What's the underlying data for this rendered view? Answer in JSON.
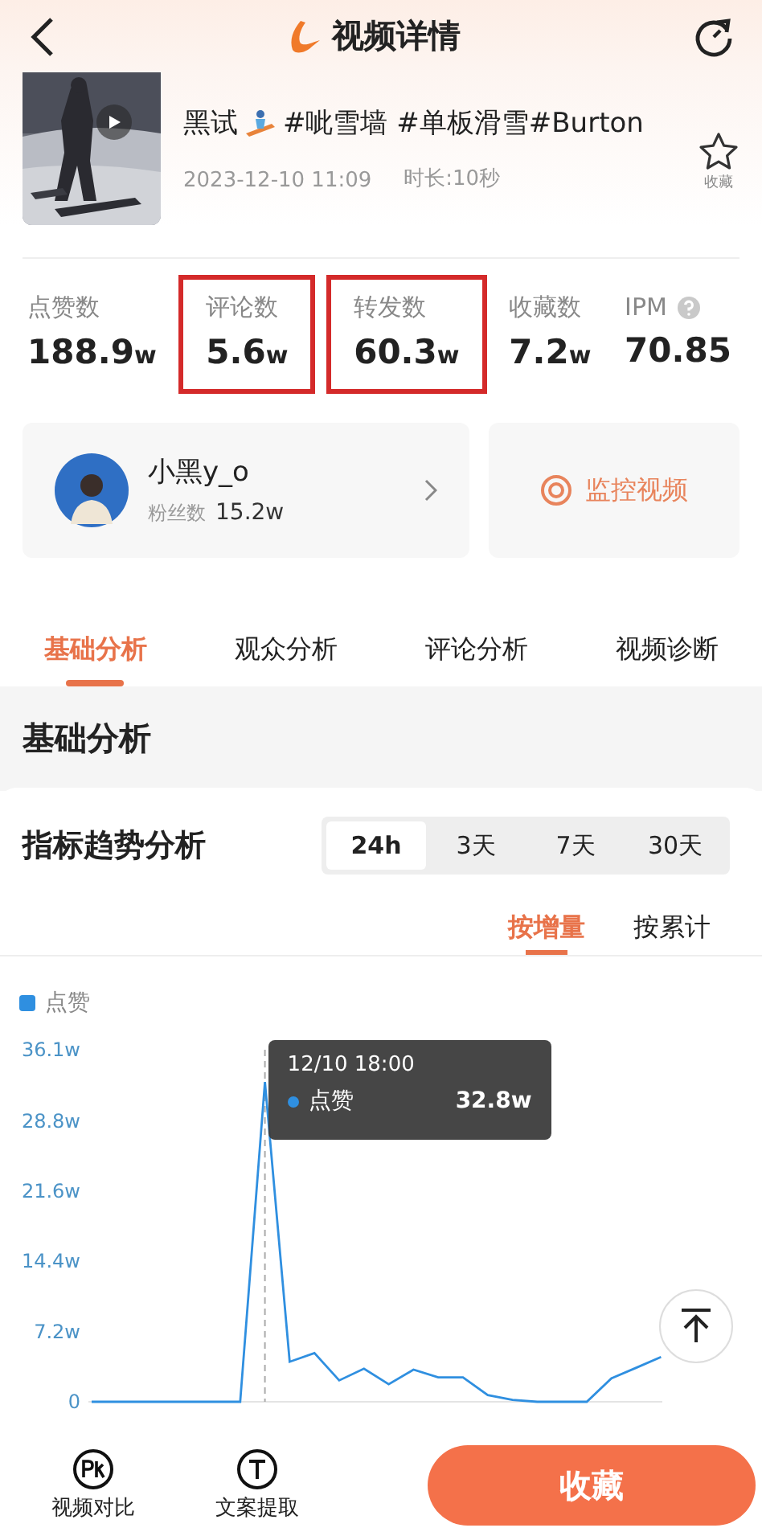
{
  "header": {
    "title": "视频详情"
  },
  "video": {
    "caption_start": "黑试",
    "caption_end": "#呲雪墙 #单板滑雪#Burton",
    "date": "2023-12-10 11:09",
    "duration": "时长:10秒",
    "favorite_label": "收藏"
  },
  "stats": [
    {
      "label": "点赞数",
      "value": "188.9",
      "unit": "w",
      "highlighted": false,
      "help": false
    },
    {
      "label": "评论数",
      "value": "5.6",
      "unit": "w",
      "highlighted": true,
      "help": false
    },
    {
      "label": "转发数",
      "value": "60.3",
      "unit": "w",
      "highlighted": true,
      "help": false
    },
    {
      "label": "收藏数",
      "value": "7.2",
      "unit": "w",
      "highlighted": false,
      "help": false
    },
    {
      "label": "IPM",
      "value": "70.85",
      "highlighted": false,
      "help": true
    }
  ],
  "author": {
    "name": "小黑y_o",
    "followers_label": "粉丝数",
    "followers": "15.2w"
  },
  "monitor_button": "监控视频",
  "tabs": [
    {
      "label": "基础分析",
      "selected": true
    },
    {
      "label": "观众分析",
      "selected": false
    },
    {
      "label": "评论分析",
      "selected": false
    },
    {
      "label": "视频诊断",
      "selected": false
    }
  ],
  "section_title": "基础分析",
  "trend": {
    "title": "指标趋势分析",
    "ranges": [
      {
        "label": "24h",
        "selected": true
      },
      {
        "label": "3天",
        "selected": false
      },
      {
        "label": "7天",
        "selected": false
      },
      {
        "label": "30天",
        "selected": false
      }
    ],
    "modes": [
      {
        "label": "按增量",
        "selected": true
      },
      {
        "label": "按累计",
        "selected": false
      }
    ],
    "chart_data": {
      "type": "line",
      "series": [
        {
          "name": "点赞",
          "color": "#2f8fe0",
          "values": [
            0,
            0,
            0,
            0,
            0,
            0,
            0,
            32.8,
            4.1,
            5.0,
            2.2,
            3.4,
            1.8,
            3.3,
            2.5,
            2.5,
            0.7,
            0.2,
            0,
            0,
            0,
            2.4,
            3.5,
            4.6
          ]
        }
      ],
      "ylim": [
        0,
        36.1
      ],
      "yticks": [
        {
          "value": 0,
          "label": "0"
        },
        {
          "value": 7.2,
          "label": "7.2w"
        },
        {
          "value": 14.4,
          "label": "14.4w"
        },
        {
          "value": 21.6,
          "label": "21.6w"
        },
        {
          "value": 28.8,
          "label": "28.8w"
        },
        {
          "value": 36.1,
          "label": "36.1w"
        }
      ]
    },
    "tooltip": {
      "time": "12/10 18:00",
      "series": "点赞",
      "value": "32.8w"
    }
  },
  "bottom_bar": {
    "actions": [
      {
        "label": "视频对比",
        "kind": "pk"
      },
      {
        "label": "文案提取",
        "kind": "text"
      }
    ],
    "primary": "收藏"
  }
}
